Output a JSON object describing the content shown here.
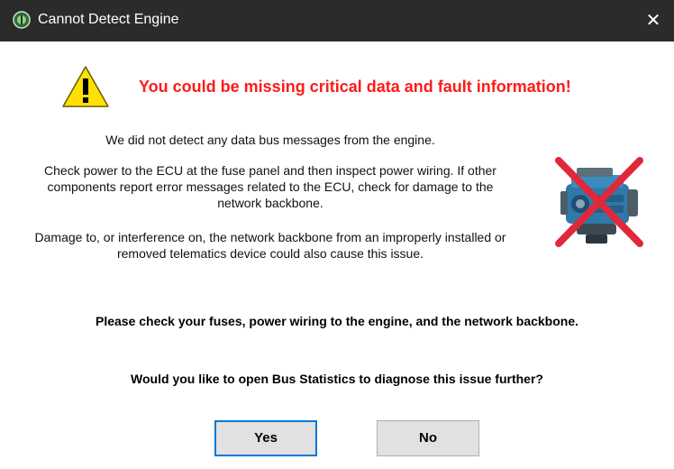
{
  "window": {
    "title": "Cannot Detect Engine",
    "close_glyph": "✕"
  },
  "icons": {
    "app": "app-logo-icon",
    "warning": "warning-triangle-icon",
    "engine": "engine-crossed-out-icon"
  },
  "dialog": {
    "headline": "You could be missing critical data and fault information!",
    "message1": "We did not detect any data bus messages from the engine.",
    "message2": "Check power to the ECU at the fuse panel and then inspect power wiring. If other components report error messages related to the ECU, check for damage to the network backbone.",
    "message3": "Damage to, or interference on, the network backbone from an improperly installed or removed telematics device could also cause this issue.",
    "instruction": "Please check your fuses, power wiring to the engine, and the network backbone.",
    "question": "Would you like to open Bus Statistics to diagnose this issue further?",
    "yes_label": "Yes",
    "no_label": "No"
  },
  "colors": {
    "titlebar": "#2b2b2b",
    "headline": "#ff1a1a",
    "warning_fill": "#ffe000",
    "default_button_border": "#0078d7",
    "cross": "#e0283a"
  }
}
